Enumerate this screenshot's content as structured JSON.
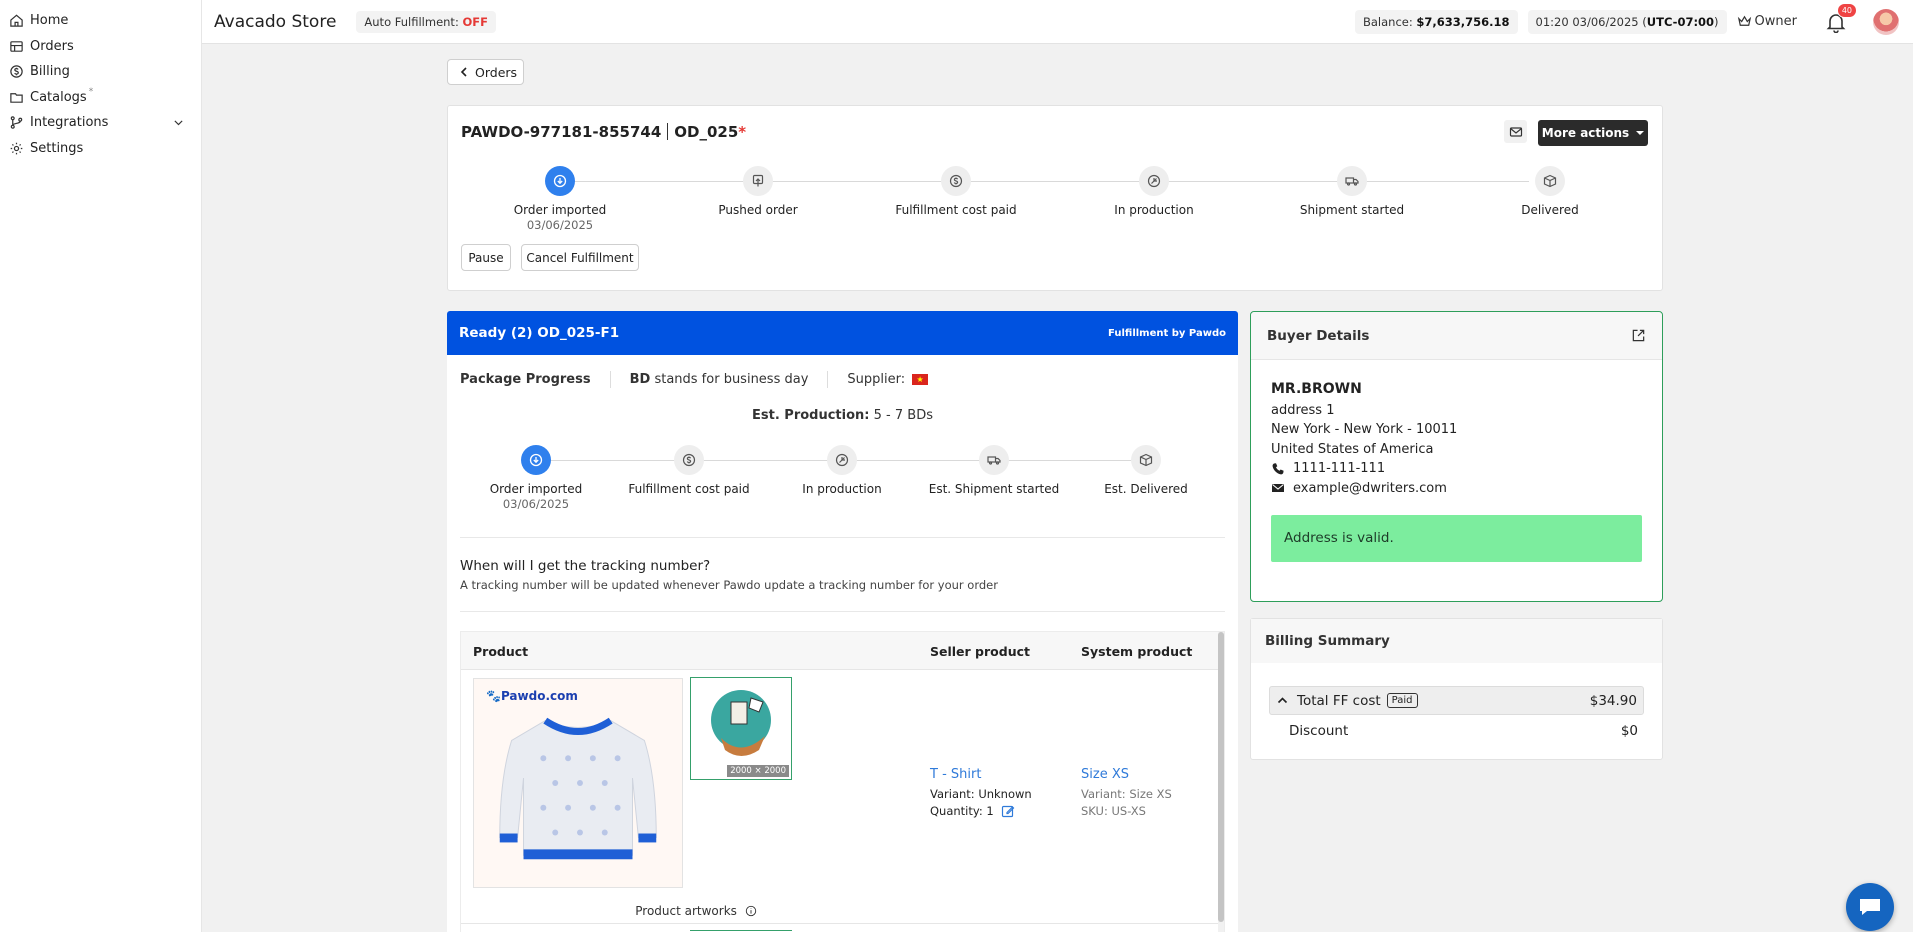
{
  "sidebar": {
    "items": [
      {
        "label": "Home",
        "icon": "home-icon"
      },
      {
        "label": "Orders",
        "icon": "orders-icon"
      },
      {
        "label": "Billing",
        "icon": "billing-icon"
      },
      {
        "label": "Catalogs",
        "icon": "catalogs-icon"
      },
      {
        "label": "Integrations",
        "icon": "integrations-icon"
      },
      {
        "label": "Settings",
        "icon": "settings-icon"
      }
    ],
    "catalogs_dot": "*"
  },
  "topbar": {
    "store_name": "Avacado Store",
    "auto_fulfillment_label": "Auto Fulfillment:",
    "auto_fulfillment_value": "OFF",
    "balance_label": "Balance:",
    "balance_value": "$7,633,756.18",
    "datetime": "01:20 03/06/2025",
    "timezone": "UTC-07:00",
    "role": "Owner",
    "notification_count": "40"
  },
  "back_button": "Orders",
  "order": {
    "id": "PAWDO-977181-855744",
    "ref": "OD_025",
    "ref_star": "*",
    "more_actions": "More actions",
    "steps": [
      {
        "label": "Order imported",
        "date": "03/06/2025",
        "active": true
      },
      {
        "label": "Pushed order",
        "date": ""
      },
      {
        "label": "Fulfillment cost paid",
        "date": ""
      },
      {
        "label": "In production",
        "date": ""
      },
      {
        "label": "Shipment started",
        "date": ""
      },
      {
        "label": "Delivered",
        "date": ""
      }
    ],
    "pause_label": "Pause",
    "cancel_label": "Cancel Fulfillment"
  },
  "package": {
    "title": "Ready (2) OD_025-F1",
    "fulfillment_by": "Fulfillment by Pawdo",
    "progress_label": "Package Progress",
    "bd_abbr": "BD",
    "bd_text": "stands for business day",
    "supplier_label": "Supplier:",
    "est_production_label": "Est. Production:",
    "est_production_value": "5 - 7 BDs",
    "steps": [
      {
        "label": "Order imported",
        "date": "03/06/2025",
        "active": true
      },
      {
        "label": "Fulfillment cost paid",
        "date": ""
      },
      {
        "label": "In production",
        "date": ""
      },
      {
        "label": "Est. Shipment started",
        "date": ""
      },
      {
        "label": "Est. Delivered",
        "date": ""
      }
    ],
    "tracking_question": "When will I get the tracking number?",
    "tracking_answer": "A tracking number will be updated whenever Pawdo update a tracking number for your order",
    "table": {
      "col_product": "Product",
      "col_seller": "Seller product",
      "col_system": "System product",
      "brand": "Pawdo.com",
      "artwork_size": "2000 × 2000",
      "seller_name": "T - Shirt",
      "seller_variant": "Variant: Unknown",
      "seller_qty": "Quantity: 1",
      "system_name": "Size XS",
      "system_variant": "Variant: Size XS",
      "system_sku": "SKU: US-XS",
      "artworks_label": "Product artworks"
    }
  },
  "buyer": {
    "title": "Buyer Details",
    "name": "MR.BROWN",
    "address1": "address 1",
    "city_line": "New York - New York - 10011",
    "country": "United States of America",
    "phone": "1111-111-111",
    "email": "example@dwriters.com",
    "valid_msg": "Address is valid."
  },
  "billing": {
    "title": "Billing Summary",
    "total_label": "Total FF cost",
    "paid_badge": "Paid",
    "total_value": "$34.90",
    "discount_label": "Discount",
    "discount_value": "$0"
  },
  "colors": {
    "primary_blue": "#0052e0",
    "step_active": "#2f80ed",
    "valid_green": "#7ced9e",
    "off_red": "#e53935"
  }
}
